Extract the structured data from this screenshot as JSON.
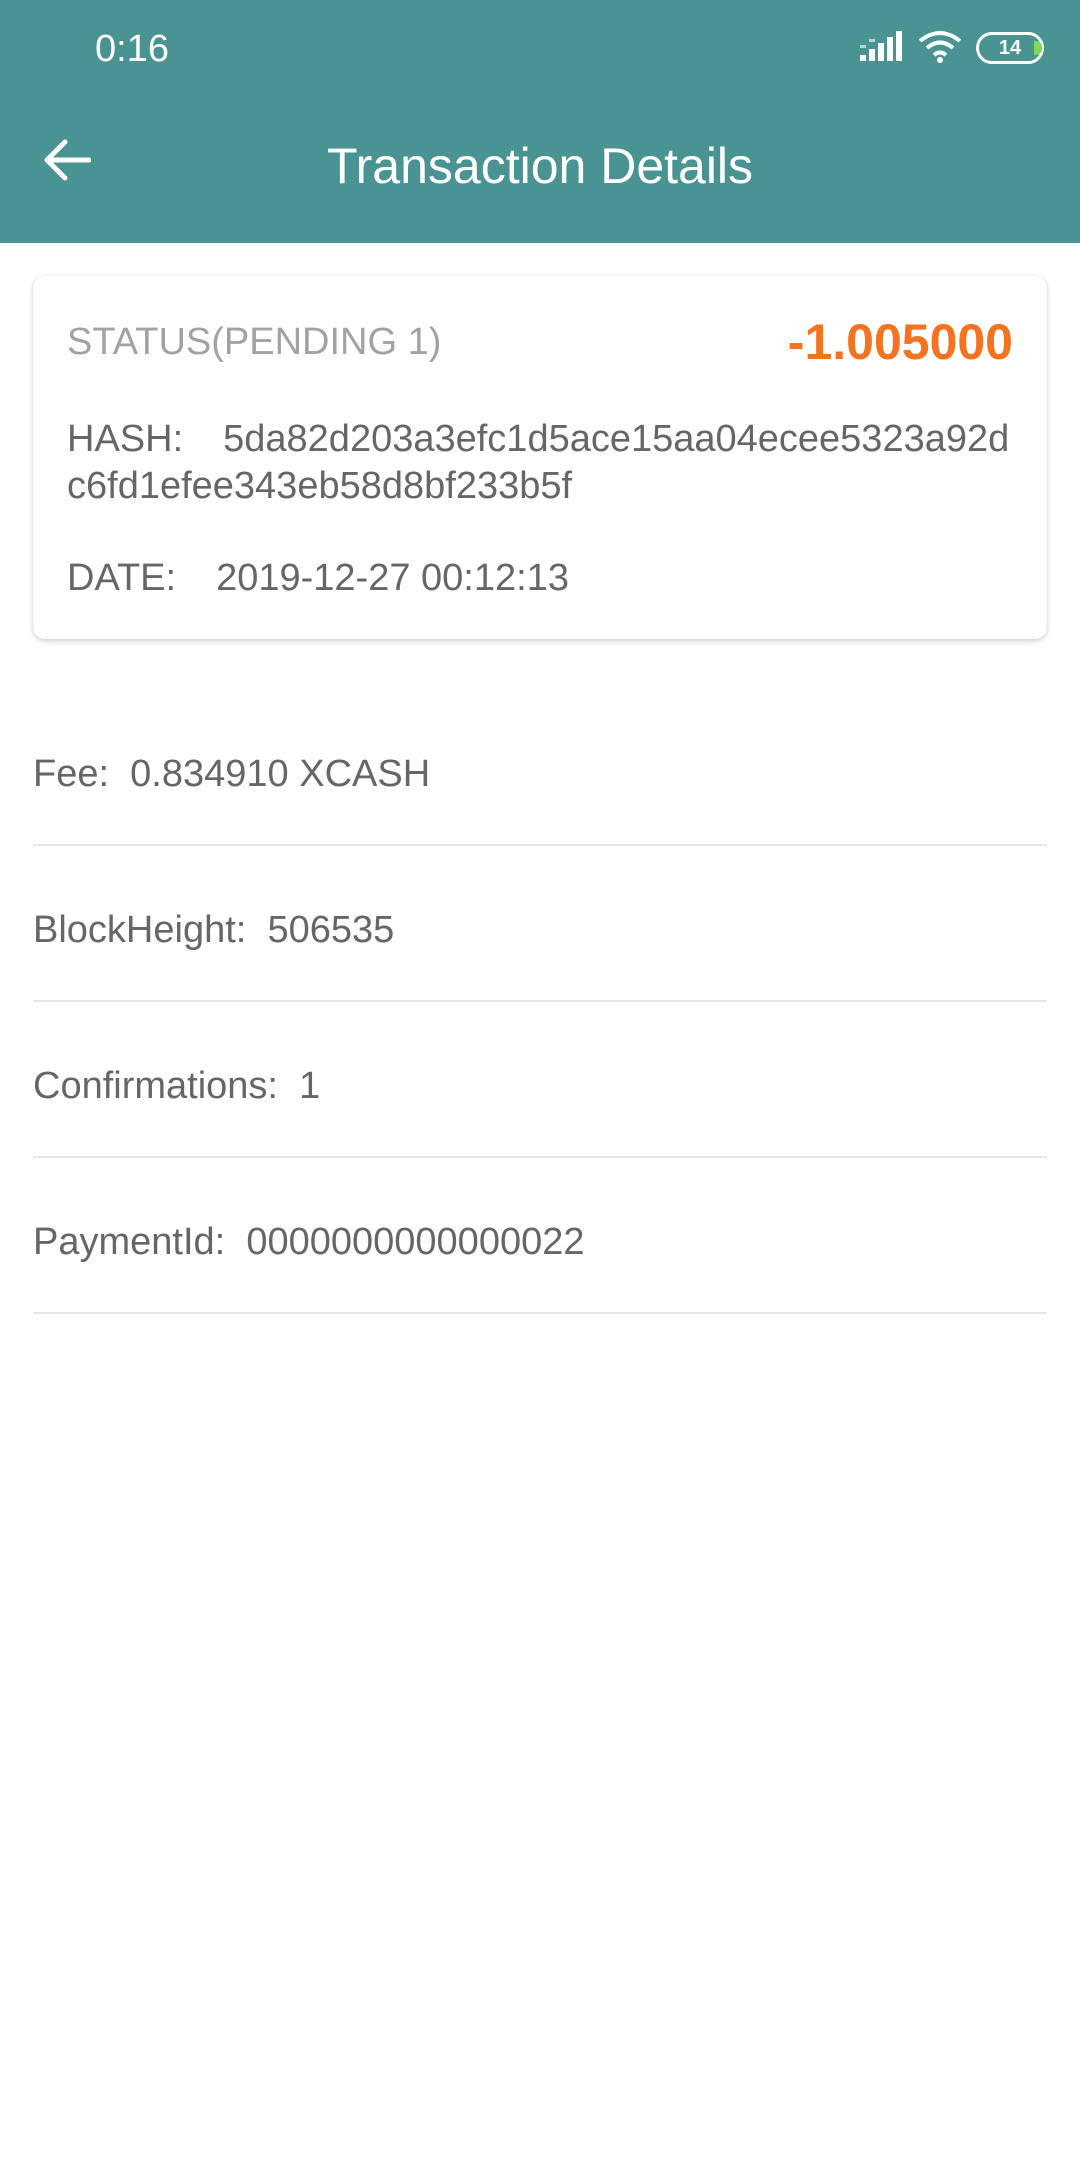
{
  "status_bar": {
    "time": "0:16",
    "battery": "14",
    "signal_icon": "signal-icon",
    "wifi_icon": "wifi-icon"
  },
  "toolbar": {
    "title": "Transaction Details",
    "back_icon": "arrow-left-icon"
  },
  "card": {
    "status": "STATUS(PENDING 1)",
    "amount": "-1.005000",
    "hash_label": "HASH:",
    "hash_value": "5da82d203a3efc1d5ace15aa04ecee5323a92dc6fd1efee343eb58d8bf233b5f",
    "date_label": "DATE:",
    "date_value": "2019-12-27 00:12:13"
  },
  "details": {
    "fee_label": "Fee:",
    "fee_value": "0.834910 XCASH",
    "block_height_label": "BlockHeight:",
    "block_height_value": "506535",
    "confirmations_label": "Confirmations:",
    "confirmations_value": "1",
    "payment_id_label": "PaymentId:",
    "payment_id_value": "0000000000000022"
  },
  "colors": {
    "app_bar": "#499393",
    "amount": "#f37321",
    "text": "#666666",
    "status_text": "#a2a2a2",
    "divider": "#e6e6e6"
  }
}
